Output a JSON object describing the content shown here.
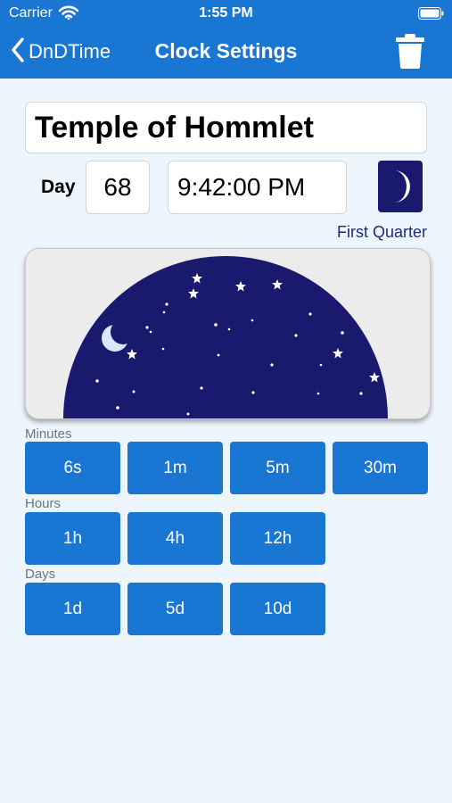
{
  "status": {
    "carrier": "Carrier",
    "time": "1:55 PM"
  },
  "nav": {
    "back_label": "DnDTime",
    "title": "Clock Settings"
  },
  "clock": {
    "name": "Temple of Hommlet",
    "day_label": "Day",
    "day": "68",
    "time": "9:42:00 PM",
    "moon_phase": "First Quarter"
  },
  "sections": {
    "minutes": {
      "label": "Minutes",
      "buttons": [
        "6s",
        "1m",
        "5m",
        "30m"
      ]
    },
    "hours": {
      "label": "Hours",
      "buttons": [
        "1h",
        "4h",
        "12h"
      ]
    },
    "days": {
      "label": "Days",
      "buttons": [
        "1d",
        "5d",
        "10d"
      ]
    }
  },
  "colors": {
    "header": "#1976d2",
    "button": "#1976d2",
    "night_sky": "#19196e",
    "background": "#eef6fd"
  },
  "icons": {
    "back": "chevron-left-icon",
    "trash": "trash-icon",
    "moon": "moon-icon",
    "wifi": "wifi-icon",
    "battery": "battery-icon"
  }
}
